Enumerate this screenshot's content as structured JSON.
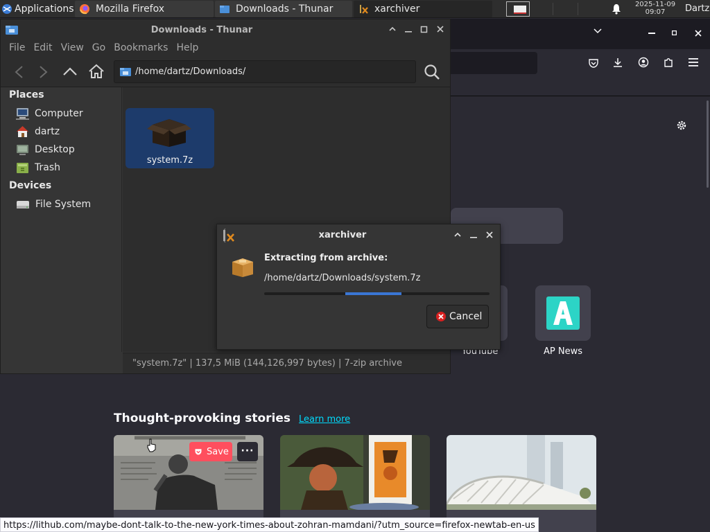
{
  "taskbar": {
    "applications_label": "Applications",
    "tasks": [
      {
        "label": "Mozilla Firefox",
        "icon": "firefox-icon"
      },
      {
        "label": "Downloads - Thunar",
        "icon": "thunar-icon"
      },
      {
        "label": "xarchiver",
        "icon": "xarchiver-icon"
      }
    ],
    "clock_date": "2025-11-09",
    "clock_time": "09:07",
    "user": "Dartz"
  },
  "thunar": {
    "title": "Downloads - Thunar",
    "menu": [
      "File",
      "Edit",
      "View",
      "Go",
      "Bookmarks",
      "Help"
    ],
    "path": "/home/dartz/Downloads/",
    "places_heading": "Places",
    "places": [
      {
        "label": "Computer",
        "icon": "computer-icon"
      },
      {
        "label": "dartz",
        "icon": "home-icon"
      },
      {
        "label": "Desktop",
        "icon": "desktop-icon"
      },
      {
        "label": "Trash",
        "icon": "trash-icon"
      }
    ],
    "devices_heading": "Devices",
    "devices": [
      {
        "label": "File System",
        "icon": "drive-icon"
      }
    ],
    "files": [
      {
        "name": "system.7z",
        "icon": "archive-icon",
        "selected": true
      }
    ],
    "status": "\"system.7z\"  |  137,5 MiB (144,126,997 bytes)  |  7-zip archive"
  },
  "xarchiver": {
    "title": "xarchiver",
    "heading": "Extracting from archive:",
    "path": "/home/dartz/Downloads/system.7z",
    "cancel_label": "Cancel",
    "progress": {
      "indeterminate": true,
      "bar_frac": 0.25
    }
  },
  "firefox": {
    "shortcuts": [
      {
        "label": "YouTube",
        "icon": "youtube-icon"
      },
      {
        "label": "AP News",
        "icon": "apnews-icon",
        "color": "#2cd4c6"
      }
    ],
    "stories_title": "Thought-provoking stories",
    "learn_more": "Learn more",
    "save_label": "Save",
    "more_label": "···",
    "status_url": "https://lithub.com/maybe-dont-talk-to-the-new-york-times-about-zohran-mamdani/?utm_source=firefox-newtab-en-us"
  },
  "colors": {
    "selection": "#1d3b6b",
    "progress": "#3a76d4",
    "save": "#ff4f5e",
    "link": "#00ddff"
  }
}
